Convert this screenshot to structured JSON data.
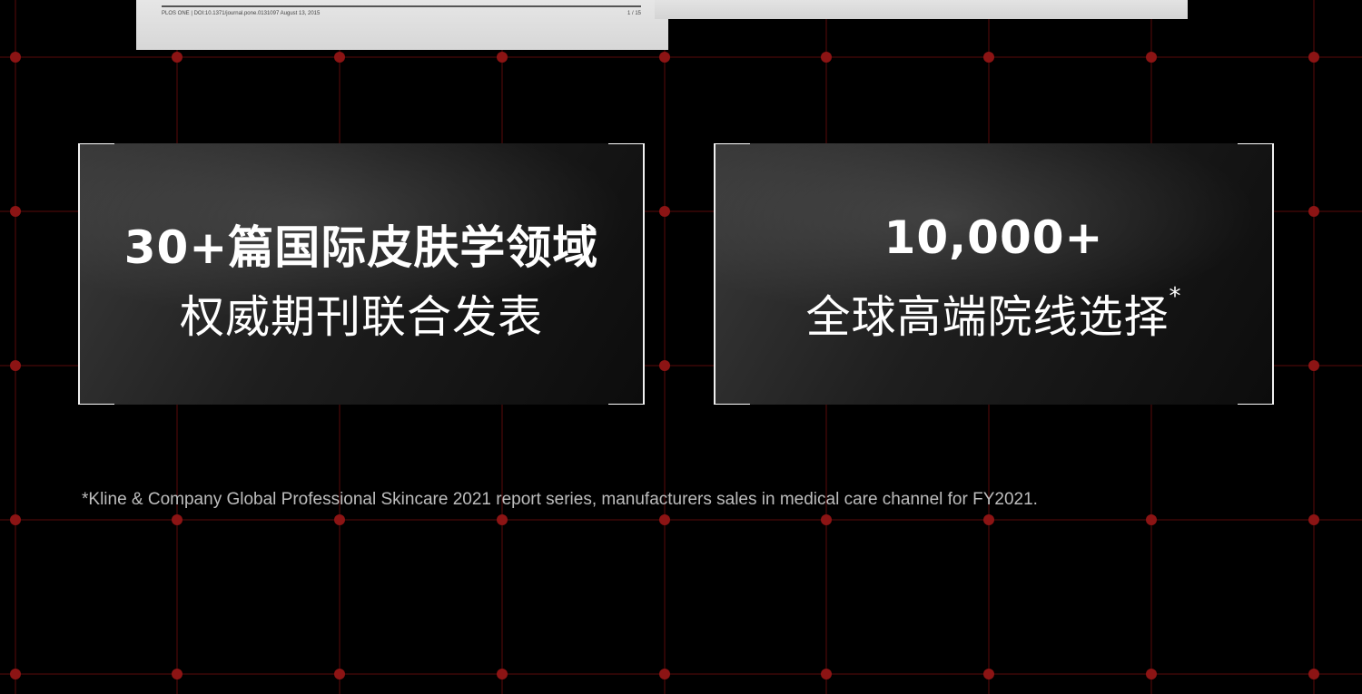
{
  "paper_left": {
    "footer_left": "PLOS ONE | DOI:10.1371/journal.pone.0131097    August 13, 2015",
    "footer_right": "1 / 15"
  },
  "card_left": {
    "line1": "30+篇国际皮肤学领域",
    "line2": "权威期刊联合发表"
  },
  "card_right": {
    "line1": "10,000+",
    "line2": "全球高端院线选择",
    "line2_mark": "*"
  },
  "footnote": "*Kline & Company Global Professional Skincare 2021 report series, manufacturers sales in medical care channel for FY2021.",
  "colors": {
    "background": "#000000",
    "grid_line": "#5a0a0a",
    "grid_dot": "#8c1414",
    "card_text": "#ffffff",
    "footnote_text": "#bdbdbd"
  }
}
